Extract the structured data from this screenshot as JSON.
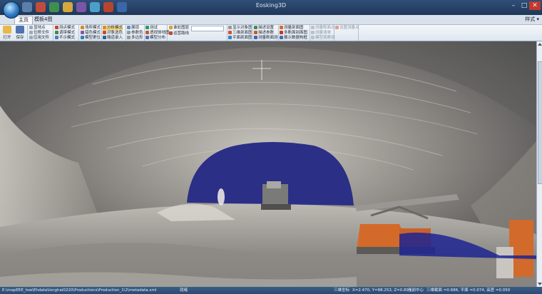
{
  "window": {
    "title": "Eosking3D",
    "minimize": "–",
    "maximize": "□",
    "close": "✕"
  },
  "tabs": [
    {
      "label": "主页"
    },
    {
      "label": "模板4图"
    }
  ],
  "ribbon_right": "样式 ▾",
  "ribbon": {
    "open": "打开",
    "save": "保存",
    "g1": [
      "显地点",
      "位移文件",
      "应用文件"
    ],
    "g2": [
      "测点模式",
      "调带模式",
      "不示模式"
    ],
    "g3": [
      "场所模式",
      "错色模式",
      "模型更位"
    ],
    "g4": [
      "分析模式",
      "对象选色",
      "隧道录入"
    ],
    "g5": [
      "展现",
      "参数色",
      "多边形"
    ],
    "g6": [
      "测试",
      "透视体地图",
      "模型分布"
    ],
    "g7": [
      "谁处图层",
      "运营路线"
    ],
    "g8": [
      "显示对象图",
      "三维剖面图",
      "平面剖面图"
    ],
    "g9": [
      "描述设置",
      "描述参数",
      "测量断面测"
    ],
    "g10": [
      "测量剖面图",
      "多断面剖面图",
      "展示数据构框"
    ],
    "g11": [
      "测量断面点",
      "测量清单",
      "模型观察测"
    ],
    "g12": [
      "设置测量点"
    ]
  },
  "status": {
    "path": "E:\\mapEEE_tsw\\Ehdata\\longhai0220\\Productions\\Production_1\\2\\metadata.xml",
    "ready": "就绪",
    "coords_label": "三维坐标",
    "coords": "X=2.470, Y=88.253, Z=0.894",
    "mode": "当前中心",
    "extents": "三维截面 =0.686, 平面 =0.074, 高差 =0.050"
  },
  "colors": {
    "accent": "#2b4a70",
    "sky": "#2b2f86"
  }
}
